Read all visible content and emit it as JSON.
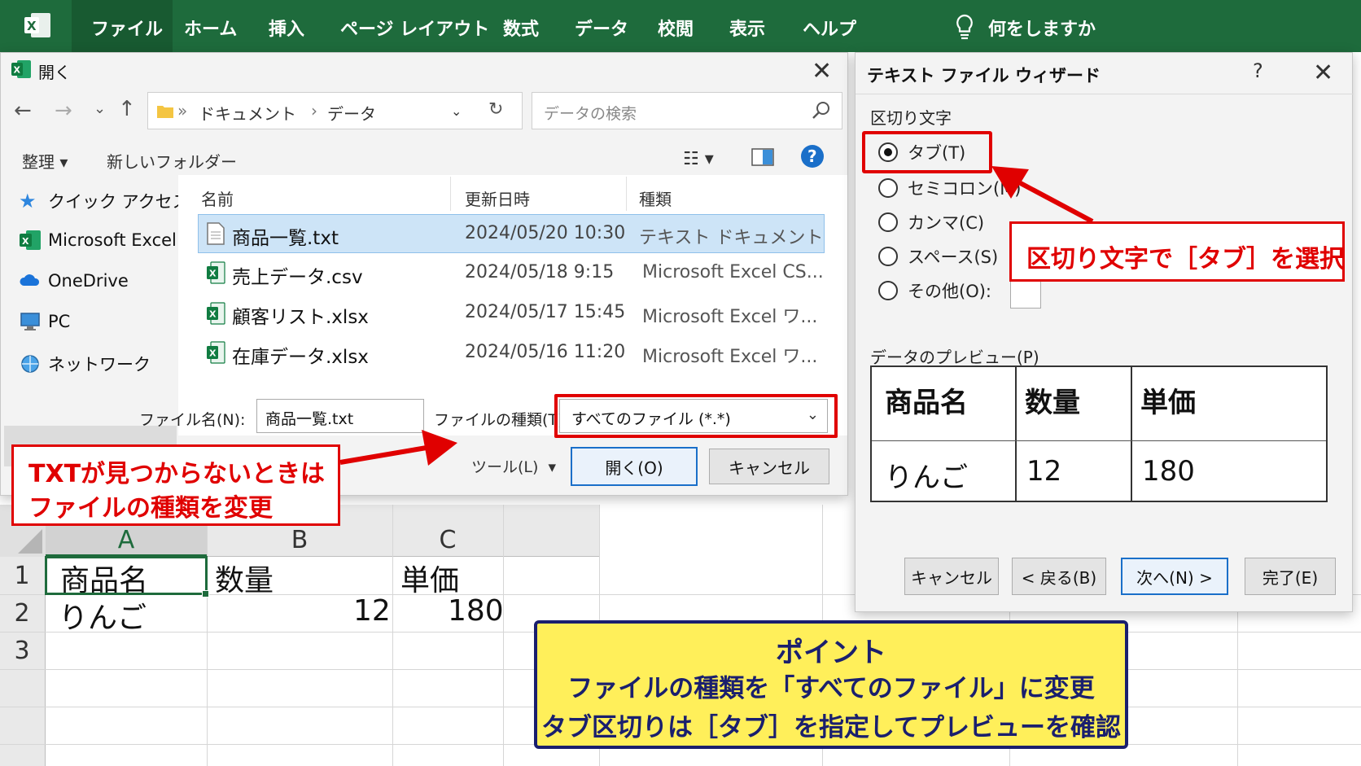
{
  "ribbon": {
    "tabs": [
      "ファイル",
      "ホーム",
      "挿入",
      "ページ レイアウト",
      "数式",
      "データ",
      "校閲",
      "表示",
      "ヘルプ"
    ],
    "tell_me": "何をしますか",
    "accent": "#1e6b3c"
  },
  "open_dialog": {
    "title": "開く",
    "path": [
      "ドキュメント",
      "データ"
    ],
    "search_placeholder": "データの検索",
    "organize": "整理",
    "new_folder": "新しいフォルダー",
    "nav": [
      {
        "label": "クイック アクセス",
        "icon": "star-icon"
      },
      {
        "label": "Microsoft Excel",
        "icon": "excel-icon"
      },
      {
        "label": "OneDrive",
        "icon": "cloud-icon"
      },
      {
        "label": "PC",
        "icon": "pc-icon"
      },
      {
        "label": "ネットワーク",
        "icon": "network-icon"
      }
    ],
    "columns": [
      "名前",
      "更新日時",
      "種類"
    ],
    "files": [
      {
        "name": "商品一覧.txt",
        "date": "2024/05/20 10:30",
        "type": "テキスト ドキュメント",
        "icon": "text-file-icon"
      },
      {
        "name": "売上データ.csv",
        "date": "2024/05/18 9:15",
        "type": "Microsoft Excel CS...",
        "icon": "excel-file-icon"
      },
      {
        "name": "顧客リスト.xlsx",
        "date": "2024/05/17 15:45",
        "type": "Microsoft Excel ワ...",
        "icon": "excel-file-icon"
      },
      {
        "name": "在庫データ.xlsx",
        "date": "2024/05/16 11:20",
        "type": "Microsoft Excel ワ...",
        "icon": "excel-file-icon"
      }
    ],
    "filename_label": "ファイル名(N):",
    "filename_value": "商品一覧.txt",
    "filetype_label": "ファイルの種類(T):",
    "filetype_value": "すべてのファイル (*.*)",
    "tools": "ツール(L)",
    "open_button": "開く(O)",
    "cancel_button": "キャンセル"
  },
  "wizard": {
    "title": "テキスト ファイル ウィザード",
    "help": "?",
    "delimiter_group": "区切り文字",
    "options": [
      "タブ(T)",
      "セミコロン(M)",
      "カンマ(C)",
      "スペース(S)",
      "その他(O):"
    ],
    "selected_option": "タブ(T)",
    "preview_label": "データのプレビュー(P)",
    "preview": {
      "header": [
        "商品名",
        "数量",
        "単価"
      ],
      "rows": [
        [
          "りんご",
          "12",
          "180"
        ]
      ]
    },
    "buttons": {
      "cancel": "キャンセル",
      "back": "< 戻る(B)",
      "next": "次へ(N) >",
      "finish": "完了(E)"
    }
  },
  "sheet": {
    "columns": [
      "A",
      "B",
      "C"
    ],
    "rows": [
      "1",
      "2",
      "3"
    ],
    "cells": {
      "A1": "商品名",
      "B1": "数量",
      "C1": "単価",
      "A2": "りんご",
      "B2": "12",
      "C2": "180"
    }
  },
  "callouts": {
    "tab_note": "区切り文字で［タブ］を選択",
    "txt_note_line1": "TXTが見つからないときは",
    "txt_note_line2": "ファイルの種類を変更",
    "point_title": "ポイント",
    "point_line1": "ファイルの種類を「すべてのファイル」に変更",
    "point_line2": "タブ区切りは［タブ］を指定してプレビューを確認",
    "red": "#e00000",
    "yellow": "#ffef5a",
    "navy": "#1a1f6e"
  }
}
